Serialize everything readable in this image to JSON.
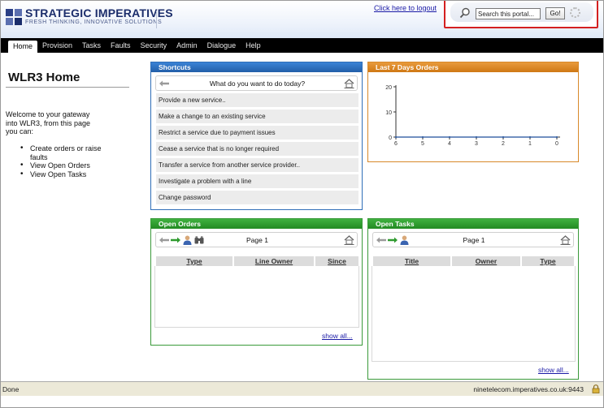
{
  "brand": {
    "name": "STRATEGIC IMPERATIVES",
    "tagline": "FRESH THINKING, INNOVATIVE SOLUTIONS"
  },
  "header": {
    "logout_label": "Click here to logout",
    "search_placeholder": "Search this portal...",
    "search_button": "Go!"
  },
  "nav": {
    "items": [
      "Home",
      "Provision",
      "Tasks",
      "Faults",
      "Security",
      "Admin",
      "Dialogue",
      "Help"
    ],
    "active": "Home"
  },
  "main": {
    "title": "WLR3 Home",
    "welcome": "Welcome to your gateway into WLR3, from this page you can:",
    "bullets": [
      "Create orders or raise faults",
      "View Open Orders",
      "View Open Tasks"
    ]
  },
  "shortcuts": {
    "title": "Shortcuts",
    "prompt": "What do you want to do today?",
    "items": [
      "Provide a new service..",
      "Make a change to an existing service",
      "Restrict a service due to payment issues",
      "Cease a service that is no longer required",
      "Transfer a service from another service provider..",
      "Investigate a problem with a line",
      "Change password"
    ]
  },
  "orders_chart": {
    "title": "Last 7 Days Orders"
  },
  "chart_data": {
    "type": "line",
    "title": "Last 7 Days Orders",
    "x": [
      "6",
      "5",
      "4",
      "3",
      "2",
      "1",
      "0"
    ],
    "series": [
      {
        "values": [
          0,
          0,
          0,
          0,
          0,
          0,
          0
        ]
      }
    ],
    "yticks": [
      "20",
      "10",
      "0"
    ],
    "ylim": [
      0,
      20
    ],
    "xlabel": "",
    "ylabel": "",
    "grid": false
  },
  "open_orders": {
    "title": "Open Orders",
    "page_label": "Page 1",
    "columns": [
      "Type",
      "Line Owner",
      "Since"
    ],
    "show_all": "show all..."
  },
  "open_tasks": {
    "title": "Open Tasks",
    "page_label": "Page 1",
    "columns": [
      "Title",
      "Owner",
      "Type"
    ],
    "show_all": "show all..."
  },
  "statusbar": {
    "left": "Done",
    "right": "ninetelecom.imperatives.co.uk:9443"
  },
  "colors": {
    "nav_bg": "#000000",
    "shortcuts_header": "#2f6eb8",
    "chart_header": "#d8892a",
    "grid_header": "#3a9a3a",
    "search_highlight": "#d42020"
  }
}
